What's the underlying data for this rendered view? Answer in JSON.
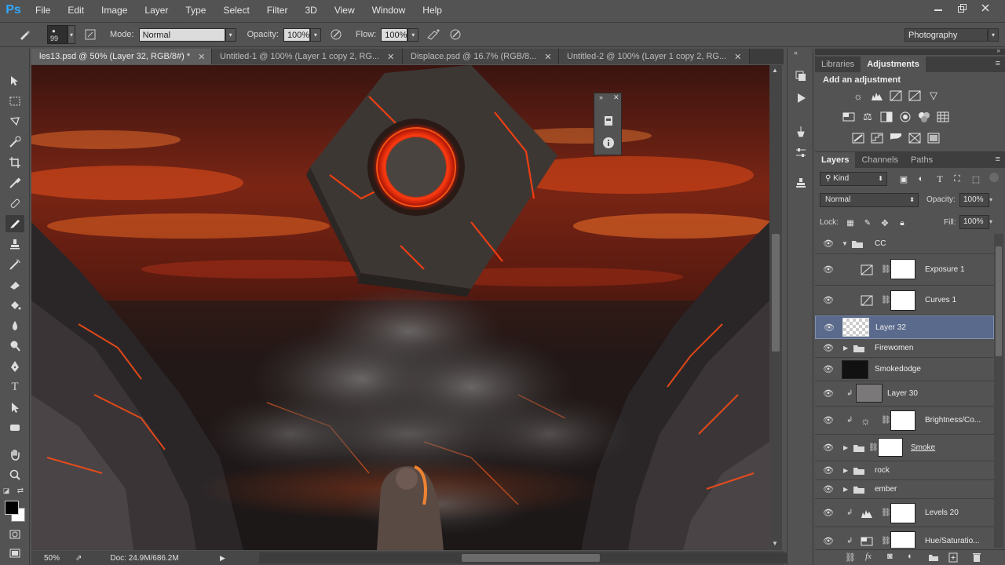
{
  "app": {
    "logo": "Ps"
  },
  "menu": [
    "File",
    "Edit",
    "Image",
    "Layer",
    "Type",
    "Select",
    "Filter",
    "3D",
    "View",
    "Window",
    "Help"
  ],
  "options": {
    "brush_size": "99",
    "mode_label": "Mode:",
    "mode_value": "Normal",
    "opacity_label": "Opacity:",
    "opacity_value": "100%",
    "flow_label": "Flow:",
    "flow_value": "100%",
    "workspace": "Photography"
  },
  "tabs": [
    {
      "label": "les13.psd @ 50% (Layer 32, RGB/8#) *",
      "active": true
    },
    {
      "label": "Untitled-1 @ 100% (Layer 1 copy 2, RG...",
      "active": false
    },
    {
      "label": "Displace.psd @ 16.7% (RGB/8...",
      "active": false
    },
    {
      "label": "Untitled-2 @ 100% (Layer 1 copy 2, RG...",
      "active": false
    }
  ],
  "status": {
    "zoom": "50%",
    "doc": "Doc: 24.9M/686.2M"
  },
  "adjust_panel": {
    "tabs": [
      "Libraries",
      "Adjustments"
    ],
    "active_tab": "Adjustments",
    "heading": "Add an adjustment"
  },
  "layers_panel": {
    "tabs": [
      "Layers",
      "Channels",
      "Paths"
    ],
    "active_tab": "Layers",
    "filter": "Kind",
    "blend_mode": "Normal",
    "opacity_label": "Opacity:",
    "opacity_value": "100%",
    "lock_label": "Lock:",
    "fill_label": "Fill:",
    "fill_value": "100%",
    "layers": [
      {
        "name": "CC",
        "type": "group-open"
      },
      {
        "name": "Exposure 1",
        "type": "adjustment"
      },
      {
        "name": "Curves 1",
        "type": "adjustment"
      },
      {
        "name": "Layer 32",
        "type": "pixel",
        "selected": true
      },
      {
        "name": "Firewomen",
        "type": "group"
      },
      {
        "name": "Smokedodge",
        "type": "pixel-black"
      },
      {
        "name": "Layer 30",
        "type": "pixel-clipped"
      },
      {
        "name": "Brightness/Co...",
        "type": "adjustment-clipped"
      },
      {
        "name": "Smoke",
        "type": "group-mask"
      },
      {
        "name": "rock",
        "type": "group"
      },
      {
        "name": "ember",
        "type": "group"
      },
      {
        "name": "Levels 20",
        "type": "adjustment-clipped"
      },
      {
        "name": "Hue/Saturatio...",
        "type": "adjustment-clipped"
      }
    ]
  },
  "colors": {
    "accent_ps": "#31a8ff",
    "selected_layer": "#5a6a8c",
    "ui_bg": "#535353"
  }
}
